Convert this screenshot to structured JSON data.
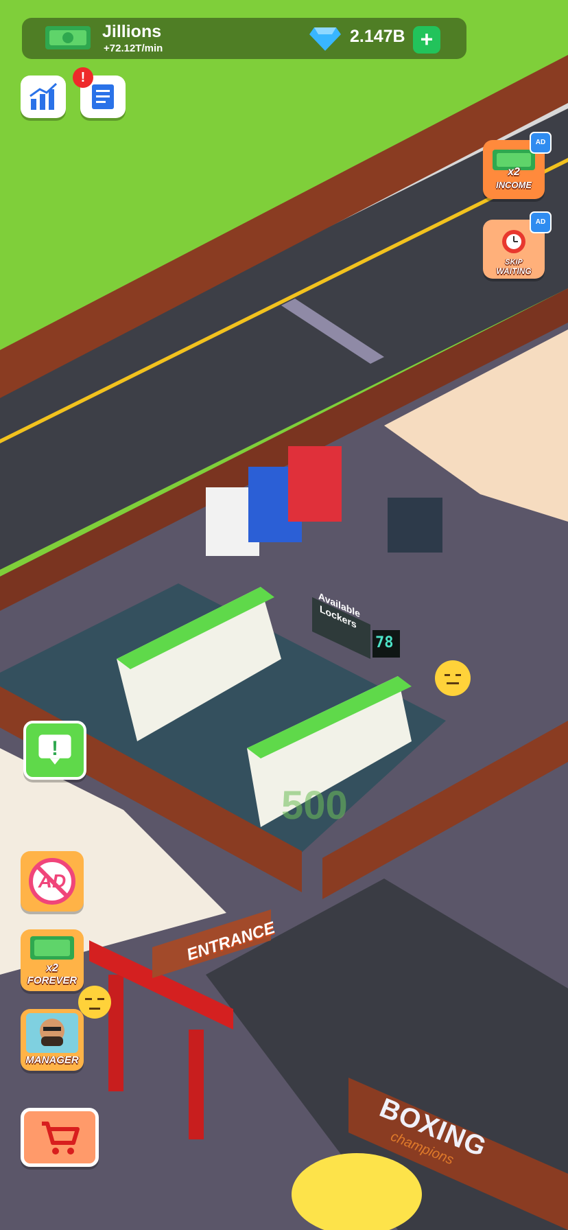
{
  "hud": {
    "currency_name": "Jillions",
    "income_rate": "+72.12T/min",
    "gem_count": "2.147B",
    "add_gems_symbol": "+"
  },
  "top_left_buttons": {
    "stats_icon": "bar-chart-icon",
    "tasks_icon": "document-icon",
    "tasks_alert": "!"
  },
  "right_boosts": {
    "income_boost": {
      "multiplier": "x2",
      "label": "INCOME",
      "badge": "AD"
    },
    "skip_waiting": {
      "line1": "SKIP",
      "line2": "WAITING",
      "badge": "AD"
    }
  },
  "left_buttons": {
    "message_alert": "!",
    "no_ads_label": "AD",
    "x2_forever": {
      "multiplier": "x2",
      "label": "FOREVER"
    },
    "manager_label": "MANAGER",
    "shop_icon": "cart-icon"
  },
  "world": {
    "lockers_sign": {
      "line1": "Available",
      "line2": "Lockers",
      "count": "78"
    },
    "entrance_sign": "ENTRANCE",
    "boxing_sign": {
      "title": "BOXING",
      "subtitle": "champions"
    },
    "upgrade_cost": "500"
  },
  "colors": {
    "grass": "#7fcf3a",
    "road": "#3d3f47",
    "floor": "#5b5669",
    "locker_floor": "#34505e",
    "fence": "#8a3c22",
    "accent_green": "#22c35b",
    "gem_blue": "#39b6ff",
    "button_orange": "#ff8a3c"
  }
}
